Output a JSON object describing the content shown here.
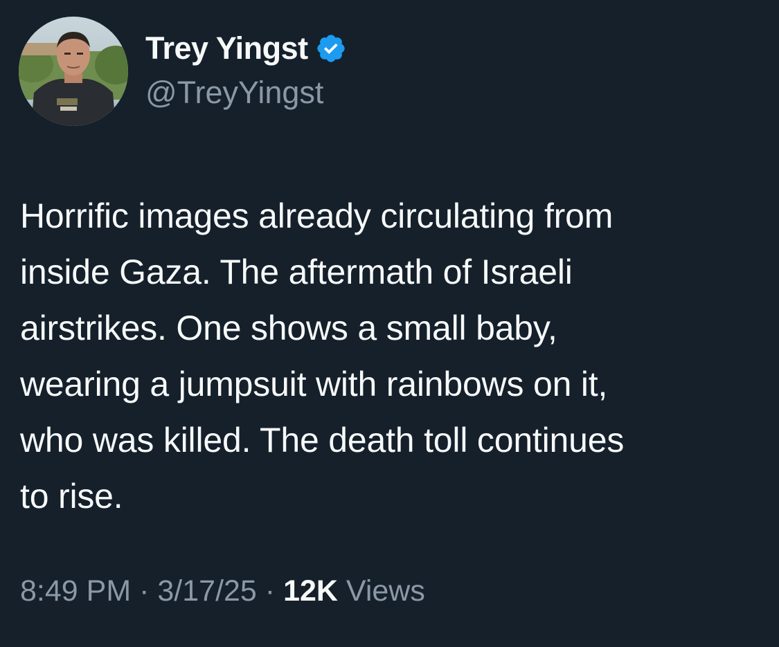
{
  "author": {
    "display_name": "Trey Yingst",
    "handle": "@TreyYingst",
    "verified_icon": "verified-badge-icon",
    "avatar_icon": "profile-photo",
    "verified_color": "#1d9bf0"
  },
  "tweet": {
    "text": "Horrific images already circulating from\ninside Gaza. The aftermath of Israeli\nairstrikes. One shows a small baby,\nwearing a jumpsuit with rainbows on it,\nwho was killed. The death toll continues\nto rise."
  },
  "meta": {
    "time": "8:49 PM",
    "separator": "·",
    "date": "3/17/25",
    "views_count": "12K",
    "views_label": "Views"
  },
  "colors": {
    "background": "#15202b",
    "primary_text": "#f7f9f9",
    "secondary_text": "#8b98a5"
  }
}
